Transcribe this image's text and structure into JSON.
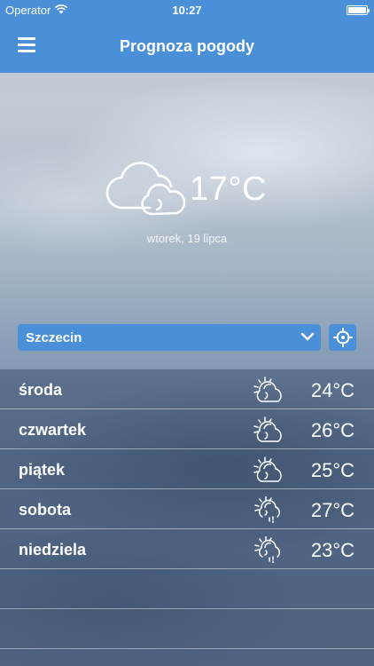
{
  "status_bar": {
    "carrier": "Operator",
    "time": "10:27"
  },
  "nav": {
    "title": "Prognoza pogody"
  },
  "current": {
    "temperature": "17°C",
    "date": "wtorek, 19 lipca",
    "icon": "cloud-icon"
  },
  "city": {
    "selected": "Szczecin"
  },
  "forecast": [
    {
      "day": "środa",
      "temp": "24°C",
      "icon": "partly-sunny-icon"
    },
    {
      "day": "czwartek",
      "temp": "26°C",
      "icon": "partly-sunny-icon"
    },
    {
      "day": "piątek",
      "temp": "25°C",
      "icon": "partly-sunny-icon"
    },
    {
      "day": "sobota",
      "temp": "27°C",
      "icon": "sun-rain-icon"
    },
    {
      "day": "niedziela",
      "temp": "23°C",
      "icon": "sun-rain-icon"
    }
  ],
  "colors": {
    "accent": "#4a90d9",
    "text": "#ffffff"
  }
}
